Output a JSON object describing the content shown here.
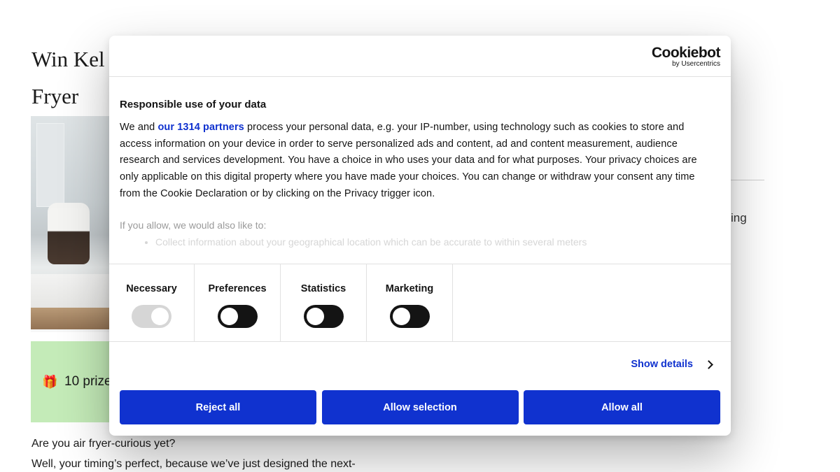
{
  "background": {
    "title_line1": "Win Kel",
    "title_line2": "Fryer",
    "prize_text": "10 prize",
    "side_text": "ing",
    "para1": "Are you air fryer-curious yet?",
    "para2": "Well, your timing’s perfect, because we’ve just designed the next-"
  },
  "dialog": {
    "logo_main": "Cookiebot",
    "logo_sub": "by Usercentrics",
    "heading": "Responsible use of your data",
    "text_before_link": "We and ",
    "link_text": "our 1314 partners",
    "text_after_link": " process your personal data, e.g. your IP-number, using technology such as cookies to store and access information on your device in order to serve personalized ads and content, ad and content measurement, audience research and services development. You have a choice in who uses your data and for what purposes. Your privacy choices are only applicable on this digital property where you have made your choices. You can change or withdraw your consent any time from the Cookie Declaration or by clicking on the Privacy trigger icon.",
    "allow_intro": "If you allow, we would also like to:",
    "allow_item": "Collect information about your geographical location which can be accurate to within several meters",
    "toggles": [
      {
        "label": "Necessary",
        "state": "on-disabled"
      },
      {
        "label": "Preferences",
        "state": "off"
      },
      {
        "label": "Statistics",
        "state": "off"
      },
      {
        "label": "Marketing",
        "state": "off"
      }
    ],
    "show_details": "Show details",
    "buttons": {
      "reject": "Reject all",
      "selection": "Allow selection",
      "allow_all": "Allow all"
    },
    "colors": {
      "accent": "#1032cf",
      "toggle_off": "#141414",
      "toggle_disabled": "#d6d6d6"
    }
  }
}
